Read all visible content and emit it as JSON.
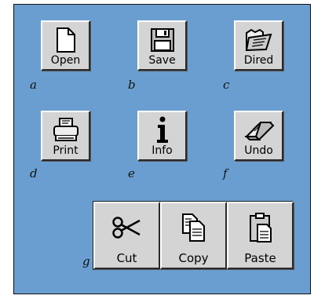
{
  "buttons": {
    "open": {
      "label": "Open",
      "letter": "a"
    },
    "save": {
      "label": "Save",
      "letter": "b"
    },
    "dired": {
      "label": "Dired",
      "letter": "c"
    },
    "print": {
      "label": "Print",
      "letter": "d"
    },
    "info": {
      "label": "Info",
      "letter": "e"
    },
    "undo": {
      "label": "Undo",
      "letter": "f"
    }
  },
  "edit_group": {
    "letter": "g",
    "cut": {
      "label": "Cut"
    },
    "copy": {
      "label": "Copy"
    },
    "paste": {
      "label": "Paste"
    }
  },
  "icons": {
    "open": "document-icon",
    "save": "floppy-disk-icon",
    "dired": "open-folder-icon",
    "print": "printer-icon",
    "info": "info-icon",
    "undo": "eraser-icon",
    "cut": "scissors-icon",
    "copy": "copy-icon",
    "paste": "clipboard-icon"
  },
  "colors": {
    "background": "#6a9ed0",
    "button": "#d4d4d4"
  }
}
